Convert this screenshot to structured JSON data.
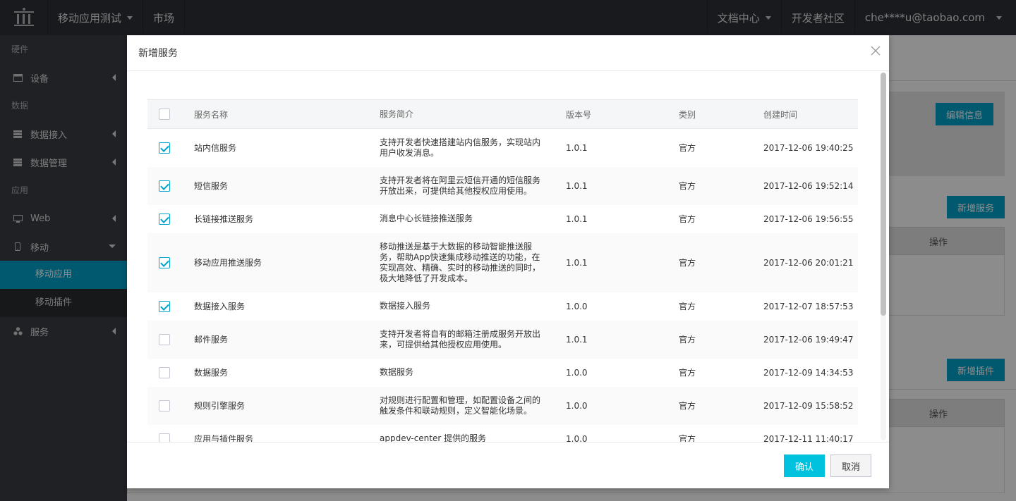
{
  "topbar": {
    "app_menu": "移动应用测试",
    "market": "市场",
    "docs": "文档中心",
    "community": "开发者社区",
    "user": "che****u@taobao.com"
  },
  "sidebar": {
    "groups": {
      "hardware": "硬件",
      "data": "数据",
      "app": "应用"
    },
    "items": {
      "device": "设备",
      "data_access": "数据接入",
      "data_manage": "数据管理",
      "web": "Web",
      "mobile": "移动",
      "mobile_app": "移动应用",
      "mobile_plugin": "移动插件",
      "service": "服务"
    }
  },
  "background": {
    "edit_info": "编辑信息",
    "add_service": "新增服务",
    "add_plugin": "新增插件",
    "op1": "操作",
    "op2": "操作"
  },
  "modal": {
    "title": "新增服务",
    "confirm": "确认",
    "cancel": "取消",
    "columns": {
      "name": "服务名称",
      "desc": "服务简介",
      "version": "版本号",
      "type": "类别",
      "time": "创建时间"
    },
    "rows": [
      {
        "checked": true,
        "name": "站内信服务",
        "desc": "支持开发者快速搭建站内信服务，实现站内用户收发消息。",
        "version": "1.0.1",
        "type": "官方",
        "time": "2017-12-06 19:40:25"
      },
      {
        "checked": true,
        "name": "短信服务",
        "desc": "支持开发者将在阿里云短信开通的短信服务开放出来，可提供给其他授权应用使用。",
        "version": "1.0.1",
        "type": "官方",
        "time": "2017-12-06 19:52:14"
      },
      {
        "checked": true,
        "name": "长链接推送服务",
        "desc": "消息中心长链接推送服务",
        "version": "1.0.1",
        "type": "官方",
        "time": "2017-12-06 19:56:55"
      },
      {
        "checked": true,
        "name": "移动应用推送服务",
        "desc": "移动推送是基于大数据的移动智能推送服务，帮助App快速集成移动推送的功能，在实现高效、精确、实时的移动推送的同时，极大地降低了开发成本。",
        "version": "1.0.1",
        "type": "官方",
        "time": "2017-12-06 20:01:21"
      },
      {
        "checked": true,
        "name": "数据接入服务",
        "desc": "数据接入服务",
        "version": "1.0.0",
        "type": "官方",
        "time": "2017-12-07 18:57:53"
      },
      {
        "checked": false,
        "name": "邮件服务",
        "desc": "支持开发者将自有的邮箱注册成服务开放出来，可提供给其他授权应用使用。",
        "version": "1.0.1",
        "type": "官方",
        "time": "2017-12-06 19:49:47"
      },
      {
        "checked": false,
        "name": "数据服务",
        "desc": "数据服务",
        "version": "1.0.0",
        "type": "官方",
        "time": "2017-12-09 14:34:53"
      },
      {
        "checked": false,
        "name": "规则引擎服务",
        "desc": "对规则进行配置和管理，如配置设备之间的触发条件和联动规则，定义智能化场景。",
        "version": "1.0.0",
        "type": "官方",
        "time": "2017-12-09 15:58:52"
      },
      {
        "checked": false,
        "name": "应用与插件服务",
        "desc": "appdev-center 提供的服务",
        "version": "1.0.0",
        "type": "官方",
        "time": "2017-12-11 11:40:17"
      }
    ]
  }
}
